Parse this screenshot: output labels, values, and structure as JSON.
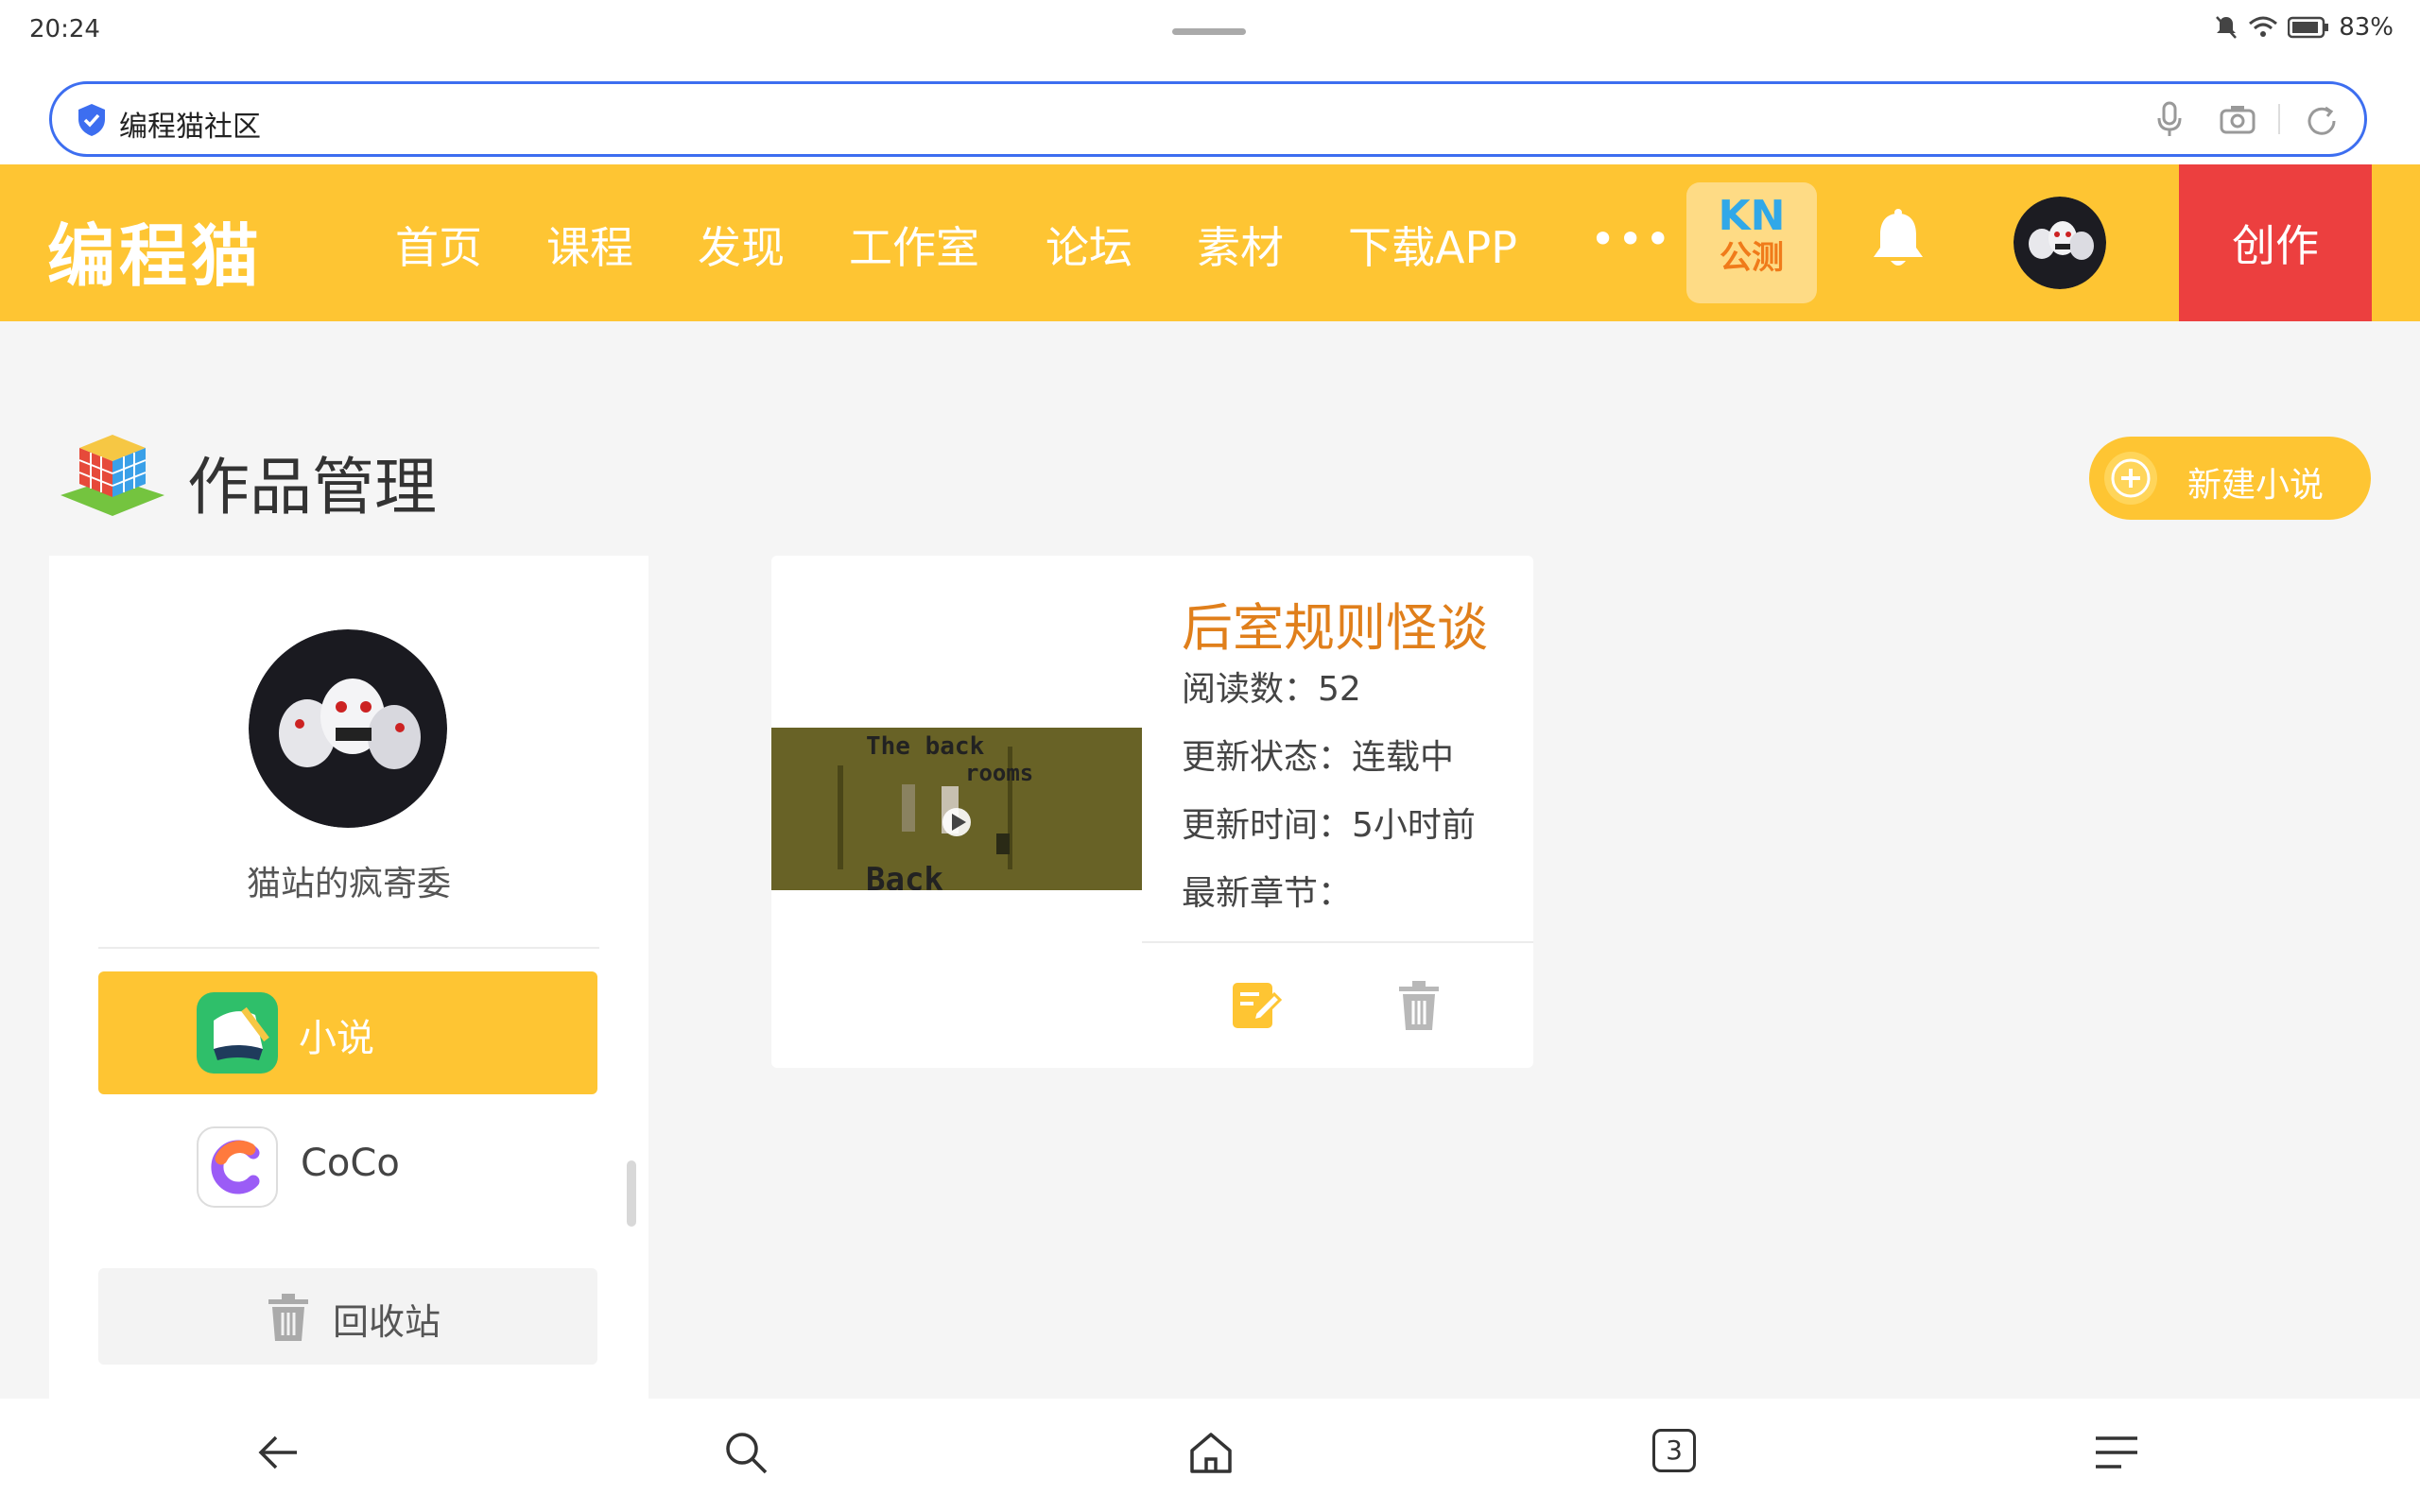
{
  "status_bar": {
    "time": "20:24",
    "battery": "83%"
  },
  "browser": {
    "address_text": "编程猫社区",
    "tabs_count": "3"
  },
  "site": {
    "logo_text": "编程猫",
    "nav": [
      "首页",
      "课程",
      "发现",
      "工作室",
      "论坛",
      "素材",
      "下载APP"
    ],
    "more": "•••",
    "kn_badge_top": "KN",
    "kn_badge_bottom": "公测",
    "create_label": "创作"
  },
  "page": {
    "title": "作品管理",
    "new_button": "新建小说"
  },
  "sidebar": {
    "username": "猫站的疯寄委",
    "items": [
      {
        "label": "小说",
        "active": true,
        "icon": "novel-app-icon"
      },
      {
        "label": "CoCo",
        "active": false,
        "icon": "coco-app-icon"
      }
    ],
    "recycle_label": "回收站"
  },
  "work": {
    "title": "后室规则怪谈",
    "meta": [
      "阅读数：52",
      "更新状态：连载中",
      "更新时间：5小时前",
      "最新章节："
    ],
    "thumbnail_text": [
      "The back",
      "rooms",
      "Back"
    ]
  },
  "colors": {
    "brand_yellow": "#fec533",
    "create_red": "#ec3f3f",
    "title_orange": "#e07f1b",
    "address_blue": "#3d6ef0"
  }
}
